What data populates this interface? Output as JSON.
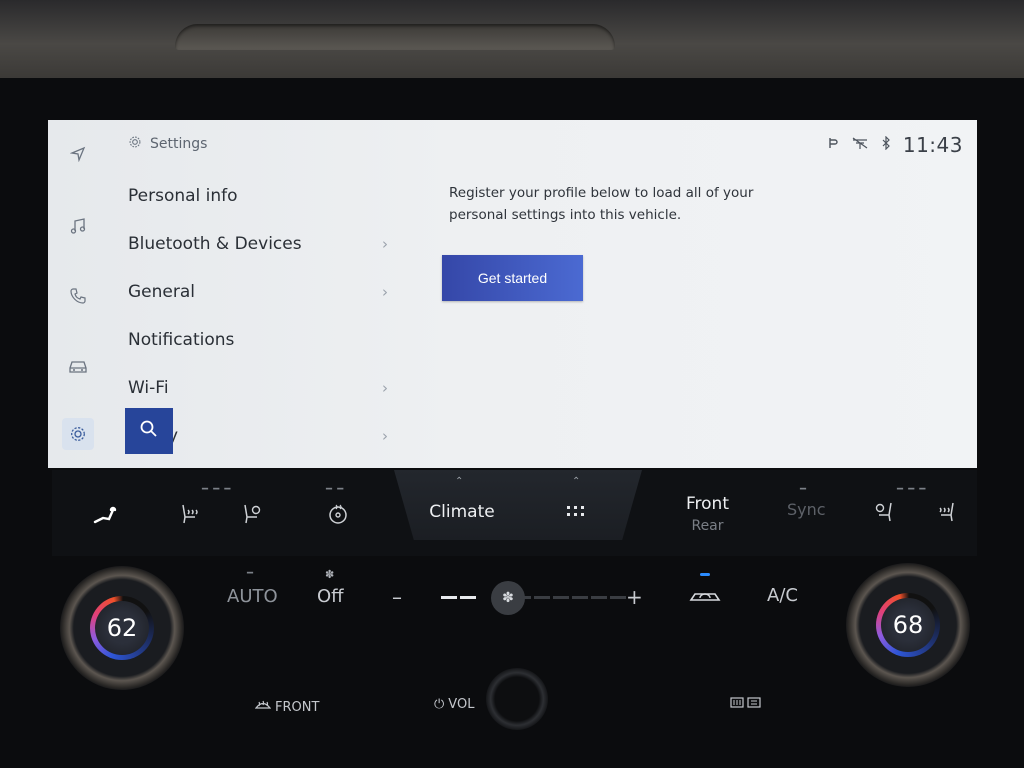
{
  "nav_rail": {
    "icons": [
      "navigation-arrow-icon",
      "music-note-icon",
      "phone-icon",
      "car-icon",
      "gear-icon"
    ],
    "active": "gear-icon"
  },
  "settings": {
    "title": "Settings",
    "menu": [
      {
        "label": "Personal info",
        "chevron": false
      },
      {
        "label": "Bluetooth & Devices",
        "chevron": true
      },
      {
        "label": "General",
        "chevron": true
      },
      {
        "label": "Notifications",
        "chevron": false
      },
      {
        "label": "Wi-Fi",
        "chevron": true
      },
      {
        "label": "y",
        "chevron": true
      }
    ]
  },
  "status_bar": {
    "icons": [
      "wireless-charging-icon",
      "no-signal-icon",
      "bluetooth-icon"
    ],
    "time": "11:43"
  },
  "profile": {
    "description": "Register your profile below to load all of your personal settings into this vehicle.",
    "cta_label": "Get started"
  },
  "climate_bar": {
    "climate_tab": "Climate",
    "front_label": "Front",
    "rear_label": "Rear",
    "sync_label": "Sync"
  },
  "climate_controls": {
    "auto_label": "AUTO",
    "fan_mode_label": "Off",
    "minus_label": "–",
    "plus_label": "+",
    "ac_label": "A/C",
    "fan_level": 2,
    "fan_max": 8,
    "left_temp": "62",
    "right_temp": "68",
    "front_defrost_label": "FRONT",
    "vol_label": "VOL"
  },
  "colors": {
    "accent_blue": "#27459a",
    "cta_start": "#3547a8",
    "cta_end": "#4b6ad2",
    "indicator": "#2b8cff"
  }
}
